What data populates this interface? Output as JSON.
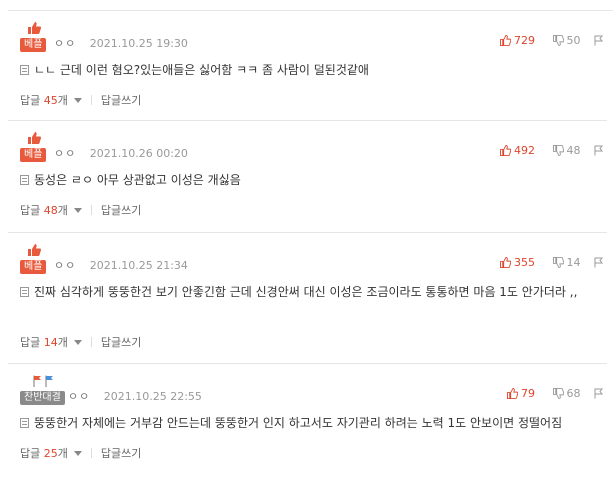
{
  "comments": [
    {
      "badge": "베플",
      "nickname": "ㅇㅇ",
      "date": "2021.10.25 19:30",
      "upvotes": "729",
      "downvotes": "50",
      "text": "ㄴㄴ 근데 이런 혐오?있는애들은 싫어함 ㅋㅋ 좀 사람이 덜된것같애",
      "reply_label": "답글",
      "reply_count": "45",
      "reply_unit": "개",
      "write_reply": "답글쓰기"
    },
    {
      "badge": "베플",
      "nickname": "ㅇㅇ",
      "date": "2021.10.26 00:20",
      "upvotes": "492",
      "downvotes": "48",
      "text": "동성은 ㄹㅇ 아무 상관없고 이성은 개싫음",
      "reply_label": "답글",
      "reply_count": "48",
      "reply_unit": "개",
      "write_reply": "답글쓰기"
    },
    {
      "badge": "베플",
      "nickname": "ㅇㅇ",
      "date": "2021.10.25 21:34",
      "upvotes": "355",
      "downvotes": "14",
      "text": "진짜 심각하게 뚱뚱한건 보기 안좋긴함 근데 신경안써 대신 이성은 조금이라도 통통하면 마음 1도 안가더라 ,,",
      "reply_label": "답글",
      "reply_count": "14",
      "reply_unit": "개",
      "write_reply": "답글쓰기"
    },
    {
      "badge": "찬반대결",
      "nickname": "ㅇㅇ",
      "date": "2021.10.25 22:55",
      "upvotes": "79",
      "downvotes": "68",
      "text": "뚱뚱한거 자체에는 거부감 안드는데 뚱뚱한거 인지 하고서도 자기관리 하려는 노력 1도 안보이면 정떨어짐",
      "reply_label": "답글",
      "reply_count": "25",
      "reply_unit": "개",
      "write_reply": "답글쓰기"
    }
  ],
  "colors": {
    "accent": "#e0442c",
    "badge_red": "#e85a3c",
    "badge_gray": "#8a8a8a",
    "meta": "#999999"
  },
  "icons": [
    "thumbs-up-icon",
    "thumbs-down-icon",
    "report-icon",
    "document-icon",
    "caret-down-icon",
    "flags-icon"
  ]
}
